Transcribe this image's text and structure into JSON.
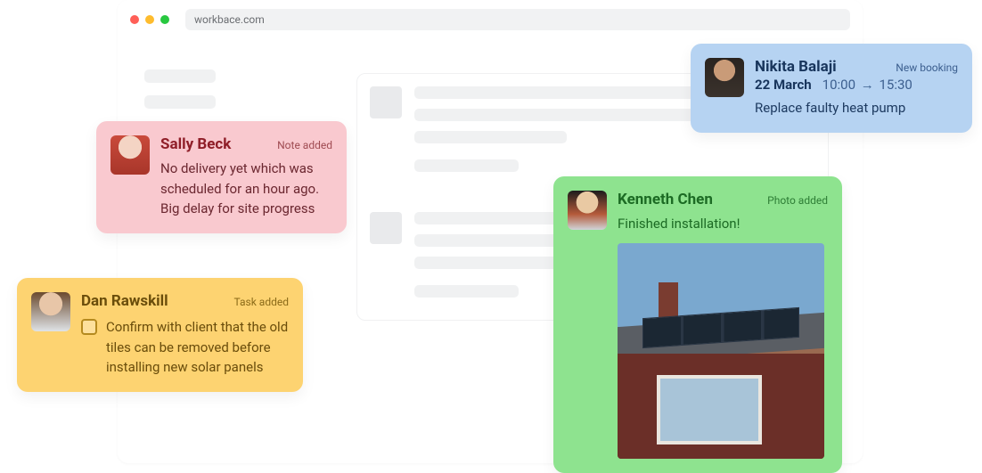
{
  "browser": {
    "url": "workbace.com"
  },
  "cards": {
    "sally": {
      "name": "Sally Beck",
      "badge": "Note added",
      "text": "No delivery yet which was scheduled for an hour ago. Big delay for site progress"
    },
    "dan": {
      "name": "Dan Rawskill",
      "badge": "Task added",
      "task": "Confirm with client that the old tiles can be removed before installing new solar panels"
    },
    "nikita": {
      "name": "Nikita Balaji",
      "badge": "New booking",
      "date": "22 March",
      "time_start": "10:00",
      "arrow": "→",
      "time_end": "15:30",
      "text": "Replace faulty heat pump"
    },
    "kenneth": {
      "name": "Kenneth Chen",
      "badge": "Photo added",
      "text": "Finished installation!"
    }
  }
}
